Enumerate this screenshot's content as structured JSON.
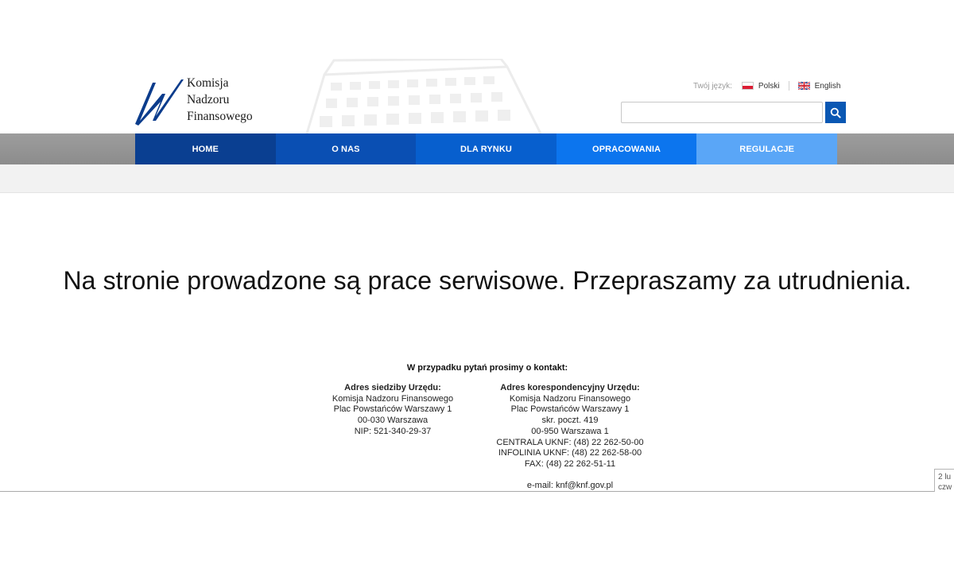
{
  "header": {
    "logo": {
      "line1": "Komisja",
      "line2": "Nadzoru",
      "line3": "Finansowego"
    },
    "lang": {
      "label": "Twój język:",
      "polski": "Polski",
      "english": "English"
    },
    "search": {
      "placeholder": "",
      "value": ""
    }
  },
  "nav": {
    "items": [
      {
        "label": "HOME"
      },
      {
        "label": "O NAS"
      },
      {
        "label": "DLA RYNKU"
      },
      {
        "label": "OPRACOWANIA"
      },
      {
        "label": "REGULACJE"
      }
    ]
  },
  "main": {
    "message": "Na stronie prowadzone są prace serwisowe. Przepraszamy za utrudnienia."
  },
  "contact": {
    "heading": "W przypadku pytań prosimy o kontakt:",
    "left": {
      "title": "Adres siedziby Urzędu:",
      "lines": [
        "Komisja Nadzoru Finansowego",
        "Plac Powstańców Warszawy 1",
        "00-030 Warszawa",
        "NIP: 521-340-29-37"
      ]
    },
    "right": {
      "title": "Adres korespondencyjny Urzędu:",
      "lines": [
        "Komisja Nadzoru Finansowego",
        "Plac Powstańców Warszawy 1",
        "skr. poczt. 419",
        "00-950 Warszawa 1",
        "CENTRALA UKNF: (48) 22 262-50-00",
        "INFOLINIA UKNF: (48) 22 262-58-00",
        "FAX: (48) 22 262-51-11"
      ]
    },
    "email": "e-mail: knf@knf.gov.pl"
  },
  "side_box": {
    "line1": "2 lu",
    "line2": "czw"
  },
  "colors": {
    "nav_home": "#0a3f91",
    "nav_onas": "#0a4fb3",
    "nav_dlarynku": "#075fce",
    "nav_opracowania": "#0c75ee",
    "nav_regulacje": "#5aa6f7",
    "search_button": "#0a57b3",
    "logo_blue": "#0b3c8c"
  }
}
